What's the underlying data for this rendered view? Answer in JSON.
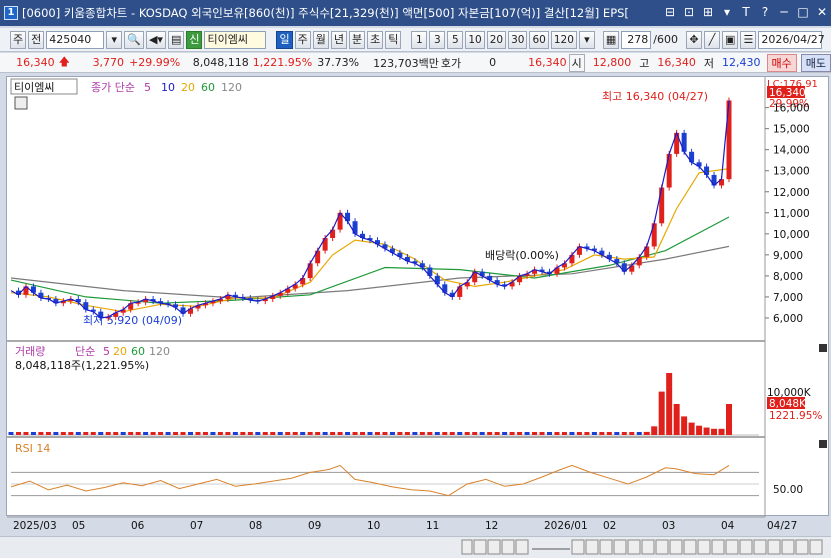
{
  "window": {
    "app_number": "1",
    "title": "[0600] 키움종합차트 - KOSDAQ 외국인보유[860(천)] 주식수[21,329(천)] 액면[500] 자본금[107(억)] 결산[12월] EPS[",
    "buttons": [
      "⊟",
      "⊡",
      "⊞",
      "▾",
      "T",
      "?",
      "─",
      "□",
      "✕"
    ]
  },
  "toolbar": {
    "type_label": "주",
    "market_label": "전",
    "code_value": "425040",
    "badge_new": "신",
    "stock_name": "티이엠씨",
    "period_tabs": [
      "일",
      "주",
      "월",
      "년",
      "분",
      "초",
      "틱"
    ],
    "active_period": "일",
    "interval_buttons": [
      "1",
      "3",
      "5",
      "10",
      "20",
      "30",
      "60",
      "120"
    ],
    "count_value": "278",
    "count_total": "/600",
    "date_value": "2026/04/27"
  },
  "price_bar": {
    "price": "16,340",
    "change": "3,770",
    "change_pct": "+29.99%",
    "volume": "8,048,118",
    "volume_ratio": "1,221.95%",
    "turnover": "37.73%",
    "amount": "123,703백만",
    "quote_label": "호가",
    "quote_value": "0",
    "quote_price": "16,340",
    "open_label": "시",
    "open": "12,800",
    "high_label": "고",
    "high": "16,340",
    "low_label": "저",
    "low": "12,430",
    "buy_label": "매수",
    "sell_label": "매도"
  },
  "chart_labels": {
    "stock_tag": "티이엠씨",
    "ma_legend": "종가 단순",
    "ma_periods": [
      "5",
      "10",
      "20",
      "60",
      "120"
    ],
    "high_annotation": "최고 16,340 (04/27)",
    "low_annotation": "최저 5,920 (04/09)",
    "dividend_annotation": "배당락(0.00%)",
    "current_price_tag": "16,340",
    "current_pct_tag": "29.99%",
    "lc_label": "LC:176.91",
    "volume_title": "거래량",
    "volume_legend": "단순",
    "volume_periods": [
      "5",
      "20",
      "60",
      "120"
    ],
    "volume_value": "8,048,118주(1,221.95%)",
    "volume_tag": "8,048K",
    "volume_pct_tag": "1221.95%",
    "volume_axis_label": "10,000K",
    "rsi_title": "RSI 14",
    "rsi_axis_label": "50.00"
  },
  "colors": {
    "up": "#e0201b",
    "down": "#1a3fd1",
    "ma5": "#1a1ac8",
    "ma20": "#e8a800",
    "ma60": "#1e9a3a",
    "ma120": "#7a7a7a",
    "rsi": "#d9822b"
  },
  "chart_data": {
    "type": "candlestick",
    "price_axis": {
      "ticks": [
        6000,
        7000,
        8000,
        9000,
        10000,
        11000,
        12000,
        13000,
        14000,
        15000,
        16000
      ],
      "labels": [
        "6,000",
        "7,000",
        "8,000",
        "9,000",
        "10,000",
        "11,000",
        "12,000",
        "13,000",
        "14,000",
        "15,000",
        "16,000"
      ]
    },
    "x_axis_labels": [
      "2025/03",
      "05",
      "06",
      "07",
      "08",
      "09",
      "10",
      "11",
      "12",
      "2026/01",
      "02",
      "03",
      "04",
      "04/27"
    ],
    "close_series": [
      [
        0,
        7300
      ],
      [
        4,
        7100
      ],
      [
        8,
        7500
      ],
      [
        12,
        7200
      ],
      [
        16,
        6950
      ],
      [
        20,
        6900
      ],
      [
        24,
        6700
      ],
      [
        28,
        6800
      ],
      [
        32,
        6900
      ],
      [
        36,
        6750
      ],
      [
        40,
        6400
      ],
      [
        44,
        6300
      ],
      [
        48,
        6000
      ],
      [
        52,
        6050
      ],
      [
        56,
        6250
      ],
      [
        60,
        6400
      ],
      [
        64,
        6700
      ],
      [
        68,
        6750
      ],
      [
        72,
        6900
      ],
      [
        76,
        6800
      ],
      [
        80,
        6700
      ],
      [
        84,
        6650
      ],
      [
        88,
        6500
      ],
      [
        92,
        6200
      ],
      [
        96,
        6450
      ],
      [
        100,
        6600
      ],
      [
        104,
        6700
      ],
      [
        108,
        6800
      ],
      [
        112,
        6900
      ],
      [
        116,
        7100
      ],
      [
        120,
        7000
      ],
      [
        124,
        6950
      ],
      [
        128,
        6850
      ],
      [
        132,
        6800
      ],
      [
        136,
        6900
      ],
      [
        140,
        7050
      ],
      [
        144,
        7200
      ],
      [
        148,
        7400
      ],
      [
        152,
        7600
      ],
      [
        156,
        7900
      ],
      [
        160,
        8600
      ],
      [
        164,
        9200
      ],
      [
        168,
        9800
      ],
      [
        172,
        10200
      ],
      [
        176,
        11000
      ],
      [
        180,
        10600
      ],
      [
        184,
        10000
      ],
      [
        188,
        9800
      ],
      [
        192,
        9700
      ],
      [
        196,
        9500
      ],
      [
        200,
        9300
      ],
      [
        204,
        9100
      ],
      [
        208,
        8900
      ],
      [
        212,
        8700
      ],
      [
        216,
        8600
      ],
      [
        220,
        8400
      ],
      [
        224,
        8000
      ],
      [
        228,
        7600
      ],
      [
        232,
        7200
      ],
      [
        236,
        7000
      ],
      [
        240,
        7500
      ],
      [
        244,
        7700
      ],
      [
        248,
        8200
      ],
      [
        252,
        8000
      ],
      [
        256,
        7800
      ],
      [
        260,
        7600
      ],
      [
        264,
        7500
      ],
      [
        268,
        7700
      ],
      [
        272,
        8000
      ],
      [
        276,
        8100
      ],
      [
        280,
        8300
      ],
      [
        284,
        8200
      ],
      [
        288,
        8100
      ],
      [
        292,
        8400
      ],
      [
        296,
        8600
      ],
      [
        300,
        9000
      ],
      [
        304,
        9400
      ],
      [
        308,
        9300
      ],
      [
        312,
        9200
      ],
      [
        316,
        9000
      ],
      [
        320,
        8800
      ],
      [
        324,
        8600
      ],
      [
        328,
        8200
      ],
      [
        332,
        8500
      ],
      [
        336,
        8900
      ],
      [
        340,
        9400
      ],
      [
        344,
        10500
      ],
      [
        348,
        12200
      ],
      [
        352,
        13800
      ],
      [
        356,
        14800
      ],
      [
        360,
        13900
      ],
      [
        364,
        13400
      ],
      [
        368,
        13200
      ],
      [
        372,
        12800
      ],
      [
        376,
        12300
      ],
      [
        380,
        12600
      ],
      [
        384,
        16340
      ]
    ],
    "ma20_series": [
      [
        0,
        7200
      ],
      [
        20,
        7000
      ],
      [
        40,
        6600
      ],
      [
        60,
        6300
      ],
      [
        80,
        6650
      ],
      [
        100,
        6550
      ],
      [
        120,
        6950
      ],
      [
        140,
        6950
      ],
      [
        160,
        7700
      ],
      [
        172,
        9000
      ],
      [
        184,
        9700
      ],
      [
        200,
        9500
      ],
      [
        216,
        8800
      ],
      [
        232,
        7800
      ],
      [
        248,
        7500
      ],
      [
        264,
        7700
      ],
      [
        280,
        8000
      ],
      [
        296,
        8300
      ],
      [
        312,
        9000
      ],
      [
        328,
        8800
      ],
      [
        344,
        8900
      ],
      [
        356,
        11200
      ],
      [
        368,
        12900
      ],
      [
        384,
        13100
      ]
    ],
    "ma60_series": [
      [
        0,
        7800
      ],
      [
        40,
        7000
      ],
      [
        80,
        6700
      ],
      [
        120,
        6850
      ],
      [
        160,
        7100
      ],
      [
        200,
        8400
      ],
      [
        240,
        8300
      ],
      [
        280,
        7900
      ],
      [
        320,
        8500
      ],
      [
        350,
        9200
      ],
      [
        384,
        10800
      ]
    ],
    "ma120_series": [
      [
        0,
        7900
      ],
      [
        60,
        7300
      ],
      [
        120,
        6950
      ],
      [
        180,
        7300
      ],
      [
        240,
        7900
      ],
      [
        300,
        8100
      ],
      [
        350,
        8800
      ],
      [
        384,
        9400
      ]
    ],
    "volume_bars": [
      [
        340,
        0.05
      ],
      [
        344,
        0.14
      ],
      [
        348,
        0.7
      ],
      [
        352,
        1.0
      ],
      [
        356,
        0.5
      ],
      [
        360,
        0.3
      ],
      [
        364,
        0.2
      ],
      [
        368,
        0.15
      ],
      [
        372,
        0.12
      ],
      [
        376,
        0.1
      ],
      [
        380,
        0.1
      ],
      [
        384,
        0.5
      ]
    ],
    "rsi_series": [
      [
        0,
        45
      ],
      [
        10,
        55
      ],
      [
        20,
        40
      ],
      [
        30,
        48
      ],
      [
        40,
        38
      ],
      [
        50,
        44
      ],
      [
        60,
        52
      ],
      [
        70,
        47
      ],
      [
        80,
        56
      ],
      [
        90,
        42
      ],
      [
        100,
        50
      ],
      [
        110,
        58
      ],
      [
        120,
        46
      ],
      [
        130,
        50
      ],
      [
        140,
        55
      ],
      [
        150,
        60
      ],
      [
        160,
        70
      ],
      [
        170,
        75
      ],
      [
        176,
        82
      ],
      [
        184,
        58
      ],
      [
        194,
        52
      ],
      [
        204,
        45
      ],
      [
        214,
        40
      ],
      [
        224,
        38
      ],
      [
        234,
        30
      ],
      [
        244,
        50
      ],
      [
        254,
        58
      ],
      [
        264,
        46
      ],
      [
        274,
        50
      ],
      [
        284,
        62
      ],
      [
        294,
        75
      ],
      [
        300,
        82
      ],
      [
        310,
        70
      ],
      [
        320,
        60
      ],
      [
        330,
        50
      ],
      [
        340,
        62
      ],
      [
        350,
        78
      ],
      [
        356,
        76
      ],
      [
        366,
        68
      ],
      [
        376,
        66
      ],
      [
        384,
        82
      ]
    ]
  }
}
